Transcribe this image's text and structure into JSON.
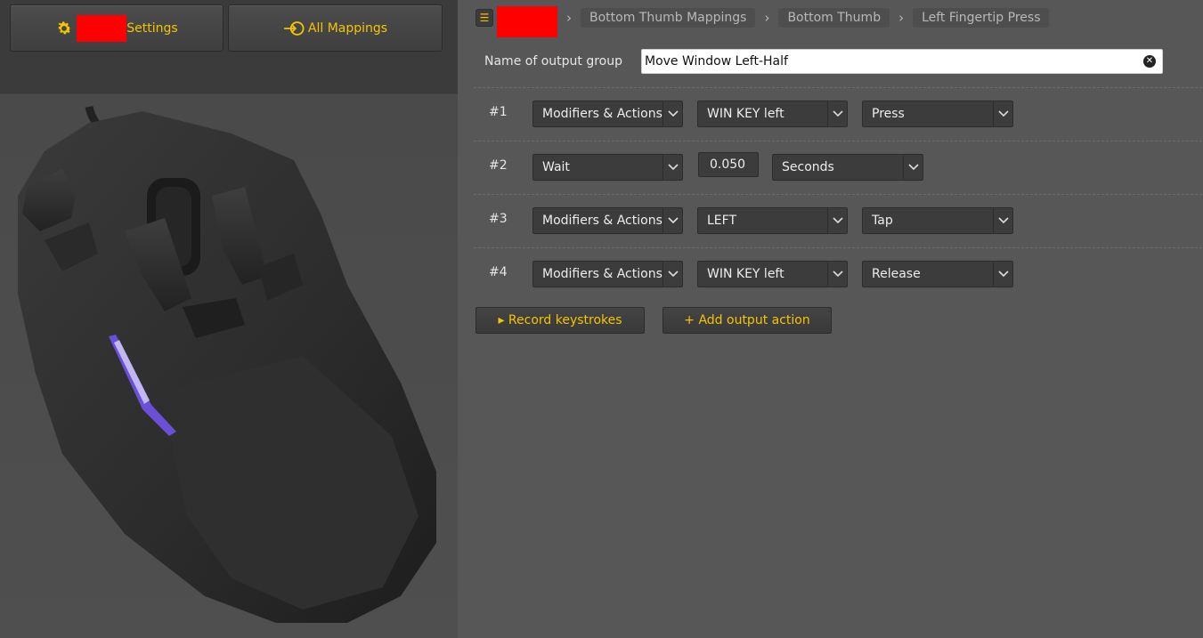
{
  "left": {
    "settings_label": "Settings",
    "mappings_label": "All Mappings"
  },
  "breadcrumb": {
    "items": [
      "Bottom Thumb Mappings",
      "Bottom Thumb",
      "Left Fingertip Press"
    ]
  },
  "output_group": {
    "label": "Name of output group",
    "value": "Move Window Left-Half"
  },
  "actions": [
    {
      "num": "#1",
      "type": "Modifiers & Actions",
      "key": "WIN KEY left",
      "mode": "Press"
    },
    {
      "num": "#2",
      "type": "Wait",
      "amount": "0.050",
      "unit": "Seconds"
    },
    {
      "num": "#3",
      "type": "Modifiers & Actions",
      "key": "LEFT",
      "mode": "Tap"
    },
    {
      "num": "#4",
      "type": "Modifiers & Actions",
      "key": "WIN KEY left",
      "mode": "Release"
    }
  ],
  "buttons": {
    "record": "▸ Record keystrokes",
    "add": "+ Add output action"
  },
  "colors": {
    "accent": "#f5c400",
    "panel_dark": "#3c3c3c",
    "background": "#575757",
    "redaction": "#ff0000"
  }
}
